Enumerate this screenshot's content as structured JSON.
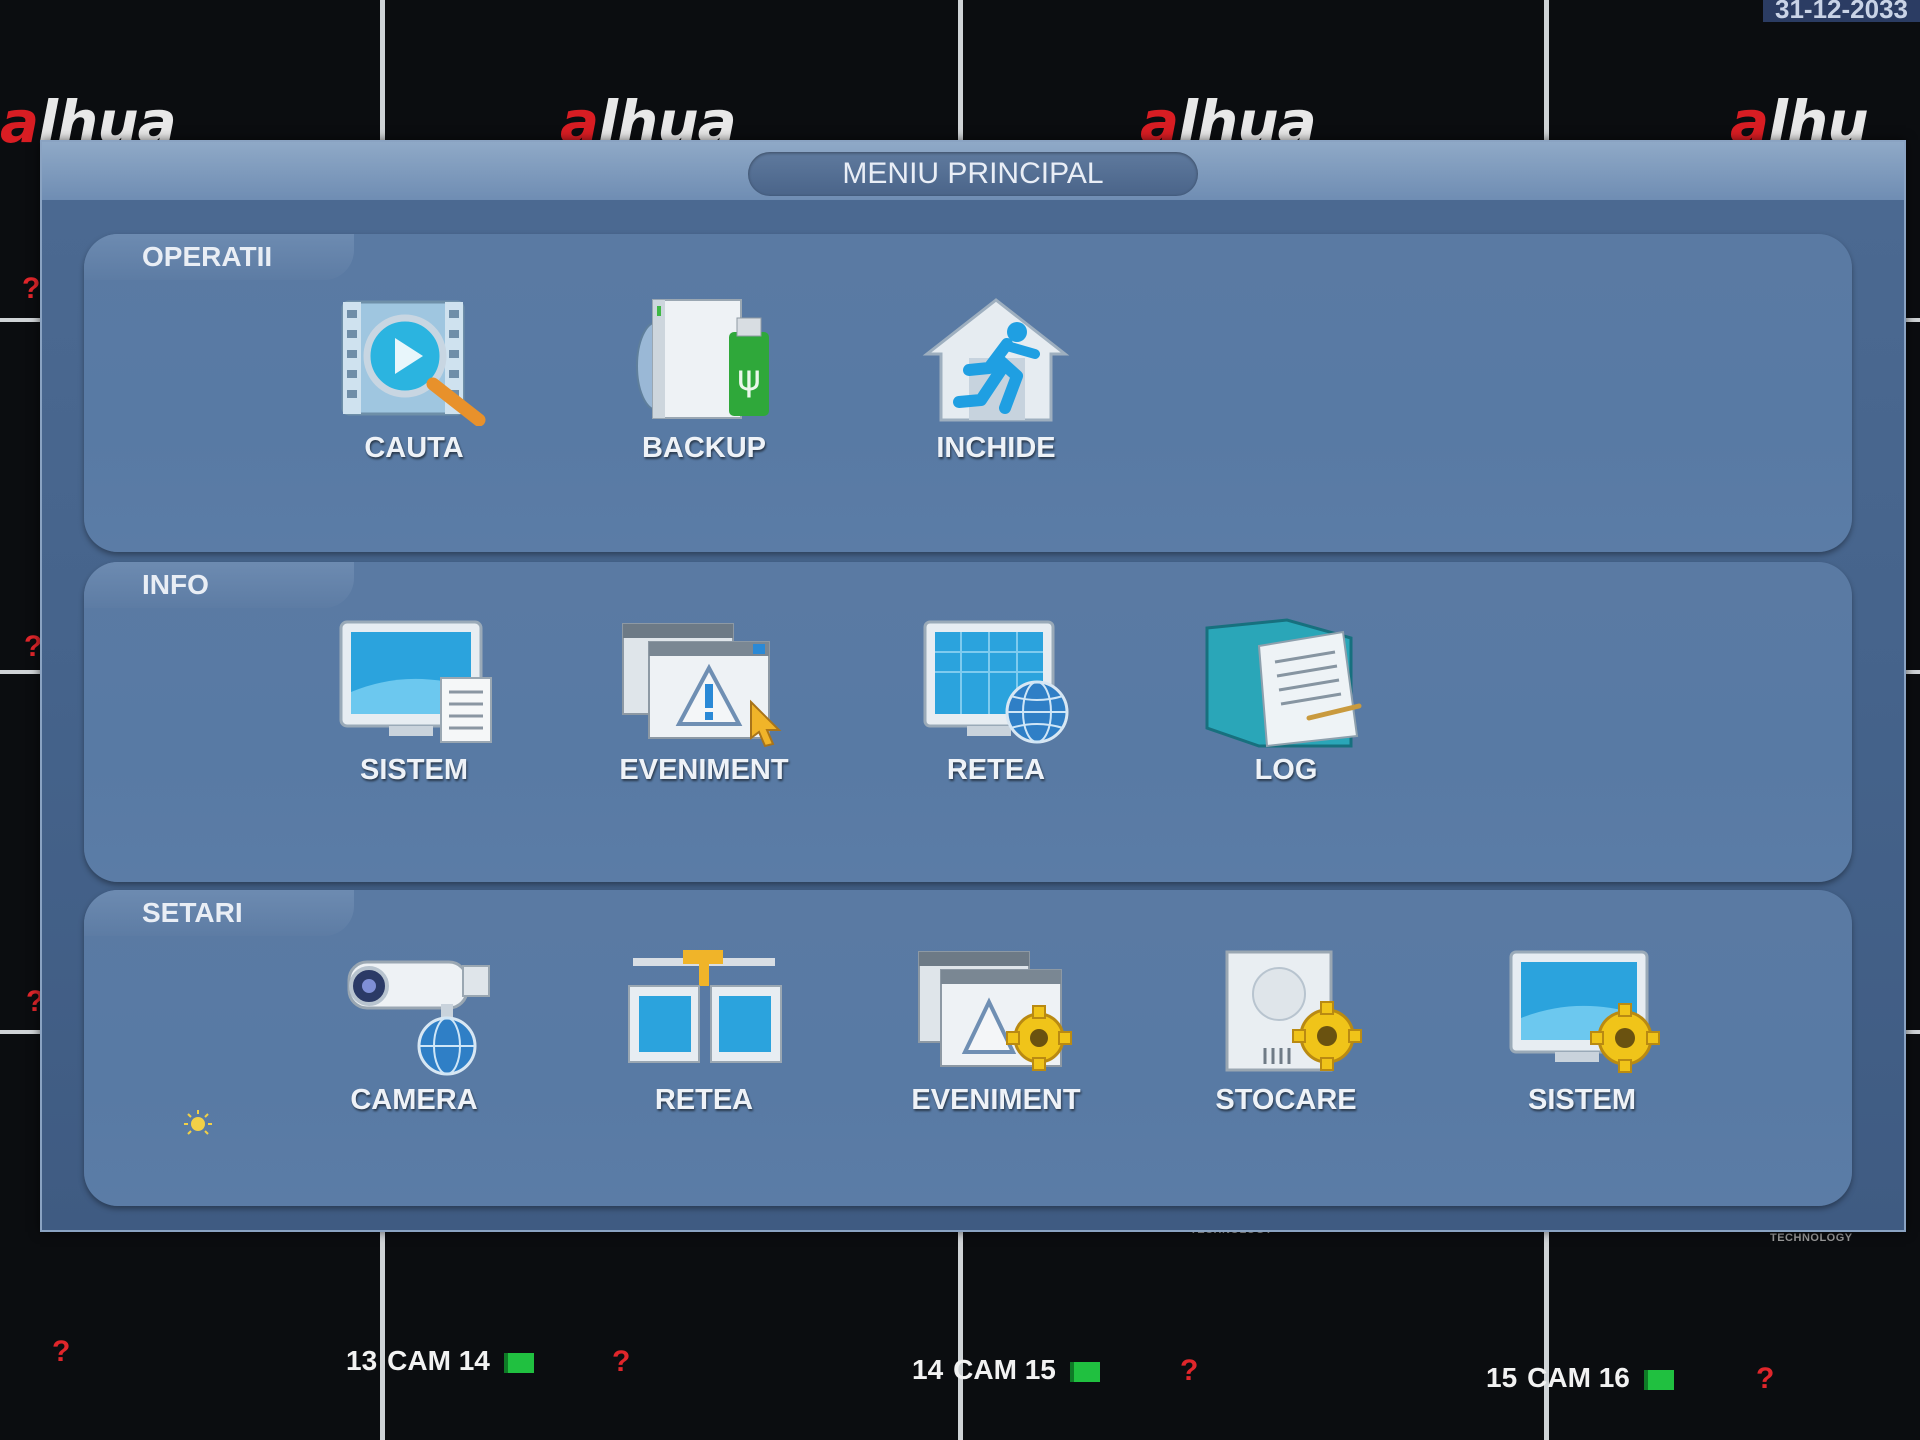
{
  "background": {
    "brand": "alhua",
    "tech_text": "TECHNOLOGY",
    "datetime": "31-12-2033",
    "cameras": [
      {
        "num": "13",
        "name": "CAM 14"
      },
      {
        "num": "14",
        "name": "CAM 15"
      },
      {
        "num": "15",
        "name": "CAM 16"
      }
    ],
    "question_mark": "?"
  },
  "window": {
    "title": "MENIU PRINCIPAL",
    "sections": [
      {
        "label": "OPERATII",
        "items": [
          {
            "label": "CAUTA",
            "icon": "search-video-icon"
          },
          {
            "label": "BACKUP",
            "icon": "usb-backup-icon"
          },
          {
            "label": "INCHIDE",
            "icon": "exit-house-icon"
          }
        ]
      },
      {
        "label": "INFO",
        "items": [
          {
            "label": "SISTEM",
            "icon": "system-info-icon"
          },
          {
            "label": "EVENIMENT",
            "icon": "event-warning-icon"
          },
          {
            "label": "RETEA",
            "icon": "network-info-icon"
          },
          {
            "label": "LOG",
            "icon": "log-folder-icon"
          }
        ]
      },
      {
        "label": "SETARI",
        "items": [
          {
            "label": "CAMERA",
            "icon": "camera-settings-icon"
          },
          {
            "label": "RETEA",
            "icon": "network-settings-icon"
          },
          {
            "label": "EVENIMENT",
            "icon": "event-settings-icon"
          },
          {
            "label": "STOCARE",
            "icon": "storage-settings-icon"
          },
          {
            "label": "SISTEM",
            "icon": "system-settings-icon"
          }
        ]
      }
    ]
  },
  "colors": {
    "accent": "#4c6a92",
    "brand_red": "#d91d23",
    "record_green": "#20c040"
  }
}
